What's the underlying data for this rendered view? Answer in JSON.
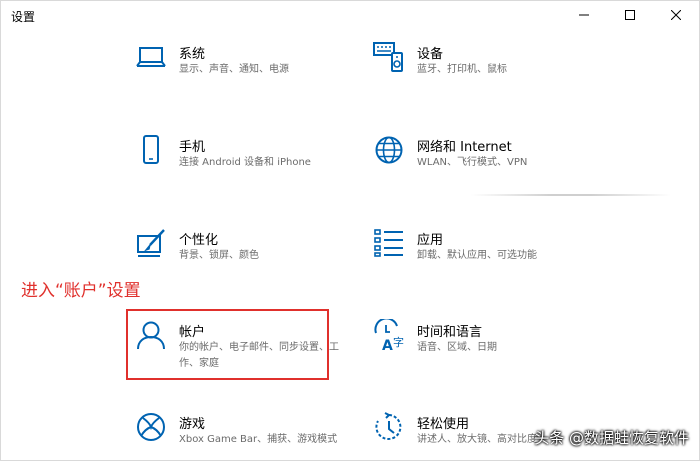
{
  "window": {
    "title": "设置",
    "controls": {
      "minimize": "minimize-icon",
      "maximize": "maximize-icon",
      "close": "close-icon"
    }
  },
  "tiles": [
    {
      "id": "system",
      "name": "系统",
      "desc": "显示、声音、通知、电源",
      "icon": "laptop-icon"
    },
    {
      "id": "devices",
      "name": "设备",
      "desc": "蓝牙、打印机、鼠标",
      "icon": "devices-icon"
    },
    {
      "id": "phone",
      "name": "手机",
      "desc": "连接 Android 设备和 iPhone",
      "icon": "phone-icon"
    },
    {
      "id": "network",
      "name": "网络和 Internet",
      "desc": "WLAN、飞行模式、VPN",
      "icon": "globe-icon"
    },
    {
      "id": "personalization",
      "name": "个性化",
      "desc": "背景、锁屏、颜色",
      "icon": "paintbrush-icon"
    },
    {
      "id": "apps",
      "name": "应用",
      "desc": "卸载、默认应用、可选功能",
      "icon": "apps-list-icon"
    },
    {
      "id": "accounts",
      "name": "帐户",
      "desc": "你的帐户、电子邮件、同步设置、工作、家庭",
      "icon": "person-icon"
    },
    {
      "id": "time",
      "name": "时间和语言",
      "desc": "语音、区域、日期",
      "icon": "time-language-icon"
    },
    {
      "id": "gaming",
      "name": "游戏",
      "desc": "Xbox Game Bar、捕获、游戏模式",
      "icon": "xbox-icon"
    },
    {
      "id": "ease",
      "name": "轻松使用",
      "desc": "讲述人、放大镜、高对比度",
      "icon": "ease-of-access-icon"
    }
  ],
  "annotation": "进入“账户”设置",
  "watermark": "头条 @数据蛙恢复软件",
  "colors": {
    "accent": "#0063b1",
    "annotation": "#e0302c",
    "desc": "#6b6b6b"
  }
}
